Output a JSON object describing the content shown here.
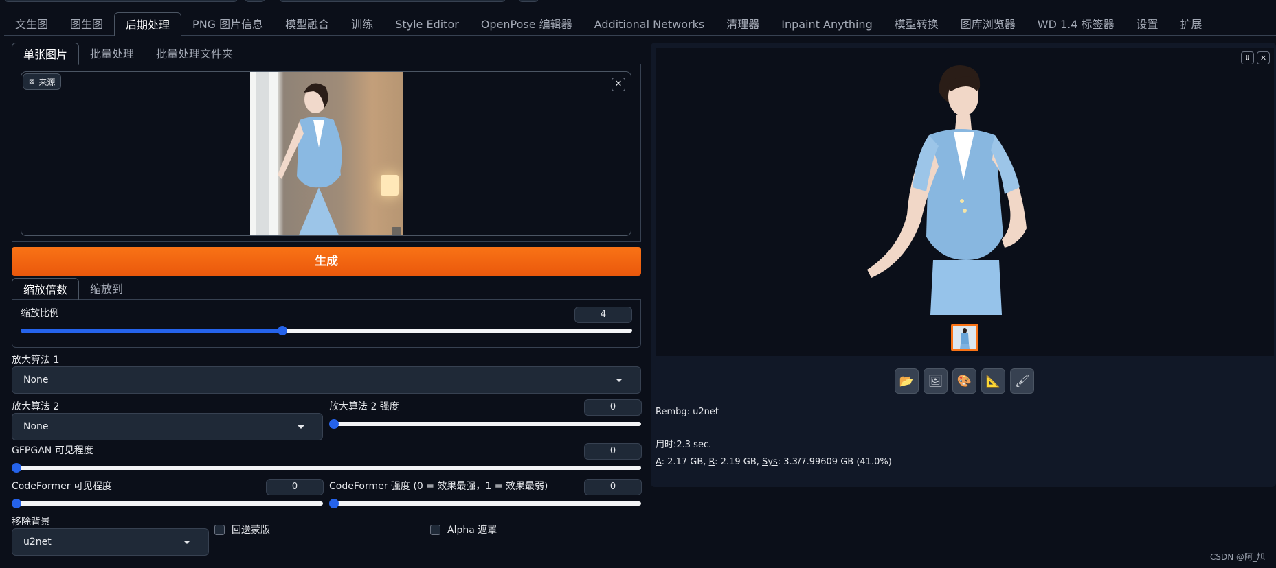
{
  "main_tabs": [
    "文生图",
    "图生图",
    "后期处理",
    "PNG 图片信息",
    "模型融合",
    "训练",
    "Style Editor",
    "OpenPose 编辑器",
    "Additional Networks",
    "清理器",
    "Inpaint Anything",
    "模型转换",
    "图库浏览器",
    "WD 1.4 标签器",
    "设置",
    "扩展"
  ],
  "active_main_tab": 2,
  "sub_tabs": [
    "单张图片",
    "批量处理",
    "批量处理文件夹"
  ],
  "source": {
    "label": "来源"
  },
  "generate_label": "生成",
  "scale_tabs": [
    "缩放倍数",
    "缩放到"
  ],
  "scale": {
    "label": "缩放比例",
    "value": "4",
    "min": 1,
    "max": 8,
    "slider_value": 4
  },
  "upscaler1": {
    "label": "放大算法 1",
    "value": "None"
  },
  "upscaler2": {
    "label": "放大算法 2",
    "value": "None"
  },
  "upscaler2_strength": {
    "label": "放大算法 2 强度",
    "value": "0",
    "fraction": 0
  },
  "gfpgan": {
    "label": "GFPGAN 可见程度",
    "value": "0",
    "fraction": 0
  },
  "codeformer_vis": {
    "label": "CodeFormer 可见程度",
    "value": "0",
    "fraction": 0
  },
  "codeformer_weight": {
    "label": "CodeFormer 强度 (0 = 效果最强，1 = 效果最弱)",
    "value": "0",
    "fraction": 0
  },
  "remove_bg": {
    "label": "移除背景",
    "value": "u2net"
  },
  "return_mask_label": "回送蒙版",
  "alpha_matting_label": "Alpha 遮罩",
  "info": {
    "rembg": "Rembg: u2net",
    "time": "用时:2.3 sec.",
    "mem_a_key": "A",
    "mem_a": ": 2.17 GB, ",
    "mem_r_key": "R",
    "mem_r": ": 2.19 GB, ",
    "mem_sys_key": "Sys",
    "mem_sys": ": 3.3/7.99609 GB (41.0%)"
  },
  "watermark": "CSDN @阿_旭",
  "icons": {
    "folder": "folder-icon",
    "image": "image-icon",
    "palette": "palette-icon",
    "ruler": "ruler-icon",
    "brush": "brush-icon"
  }
}
